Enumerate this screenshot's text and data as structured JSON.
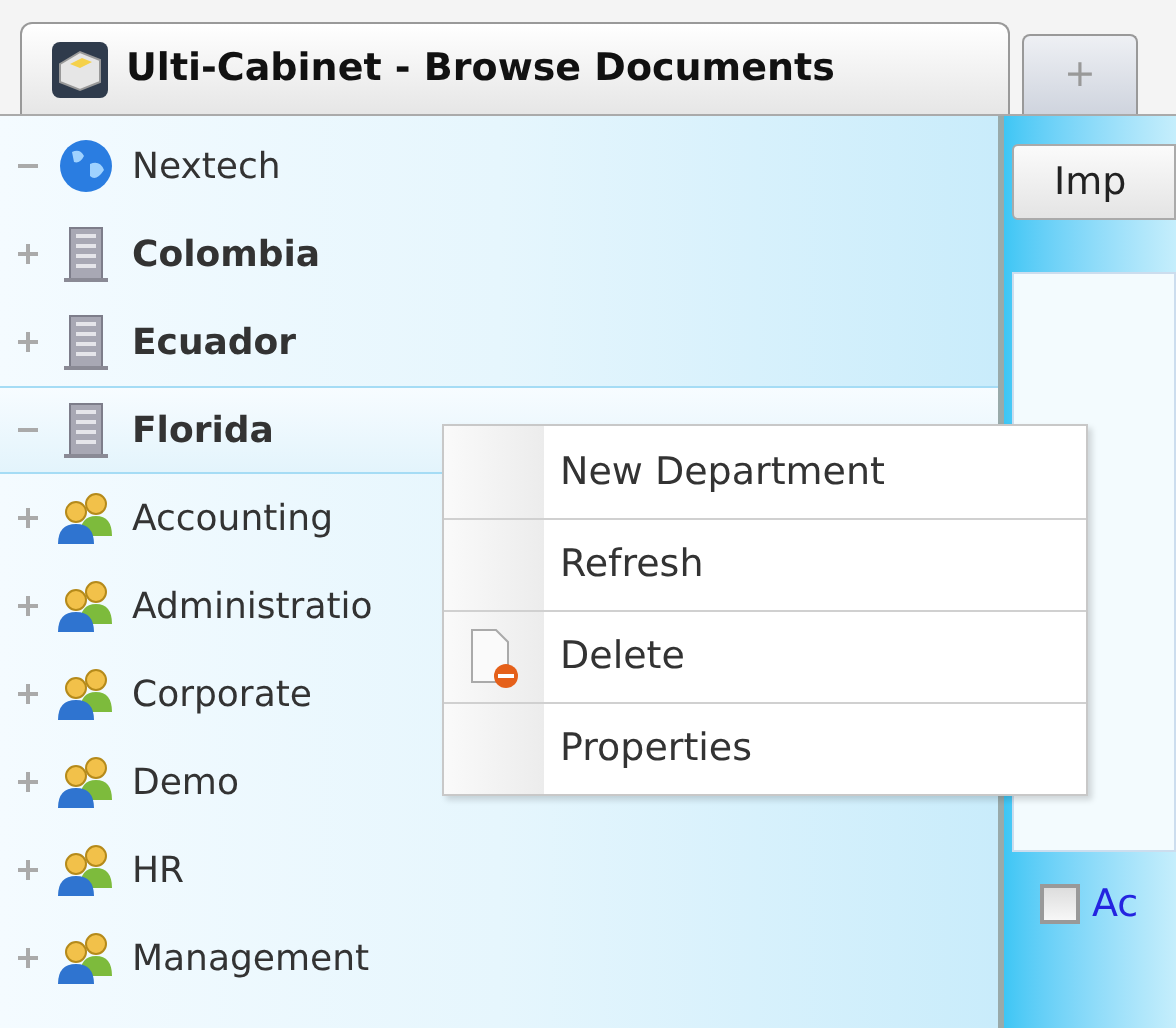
{
  "tabs": [
    {
      "label": "Ulti-Cabinet - Browse Documents",
      "selected": true,
      "kind": "app"
    },
    {
      "label": "+",
      "selected": false,
      "kind": "add"
    }
  ],
  "tree": [
    {
      "label": "Nextech",
      "kind": "globe",
      "expanded": true,
      "selected": false
    },
    {
      "label": "Colombia",
      "kind": "building",
      "expanded": false,
      "selected": false
    },
    {
      "label": "Ecuador",
      "kind": "building",
      "expanded": false,
      "selected": false
    },
    {
      "label": "Florida",
      "kind": "building",
      "expanded": true,
      "selected": true
    },
    {
      "label": "Accounting",
      "kind": "group",
      "expanded": false,
      "selected": false
    },
    {
      "label": "Administratio",
      "kind": "group",
      "expanded": false,
      "selected": false
    },
    {
      "label": "Corporate",
      "kind": "group",
      "expanded": false,
      "selected": false
    },
    {
      "label": "Demo",
      "kind": "group",
      "expanded": false,
      "selected": false
    },
    {
      "label": "HR",
      "kind": "group",
      "expanded": false,
      "selected": false
    },
    {
      "label": "Management",
      "kind": "group",
      "expanded": false,
      "selected": false
    }
  ],
  "context_menu": [
    {
      "label": "New Department",
      "kind": "plain"
    },
    {
      "label": "Refresh",
      "kind": "plain"
    },
    {
      "label": "Delete",
      "kind": "delete"
    },
    {
      "label": "Properties",
      "kind": "plain"
    }
  ],
  "right_panel": {
    "button": "Imp",
    "checkbox": {
      "label": "Ac",
      "checked": false
    }
  }
}
